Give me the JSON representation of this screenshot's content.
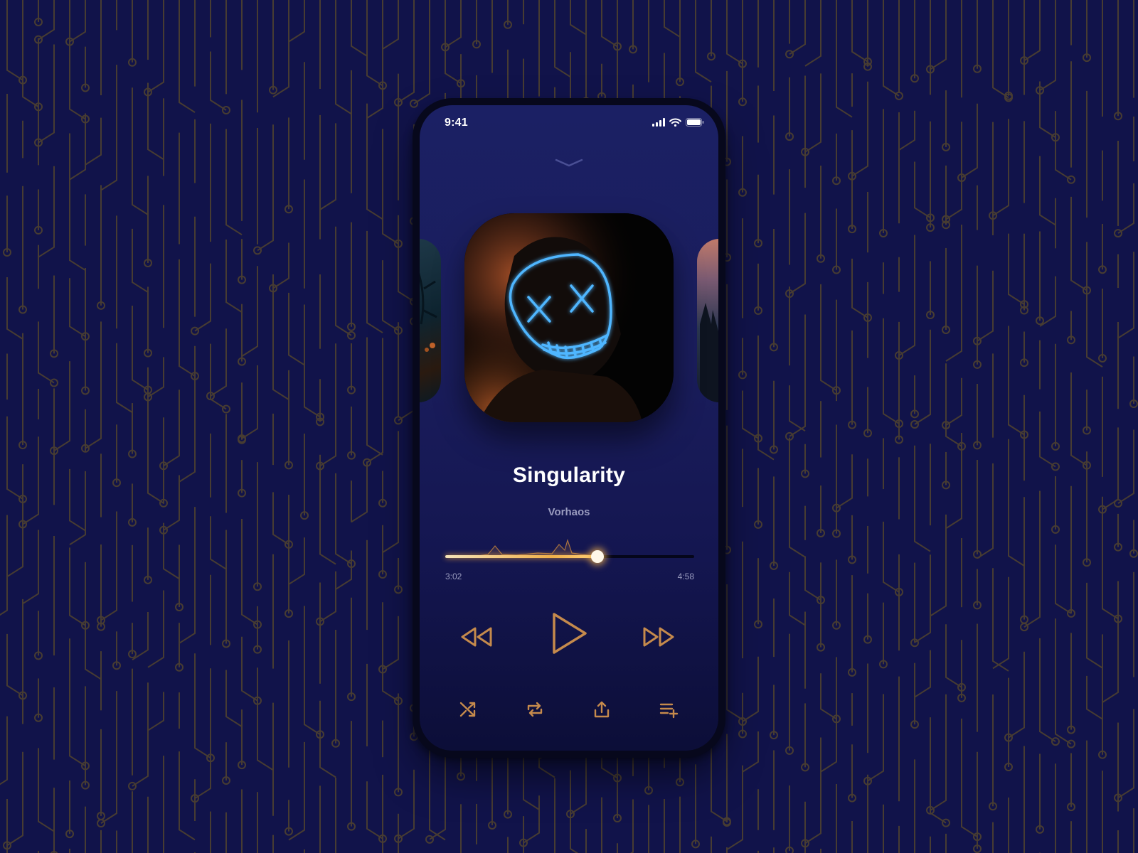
{
  "status_bar": {
    "time": "9:41"
  },
  "now_playing": {
    "title": "Singularity",
    "artist": "Vorhaos",
    "elapsed": "3:02",
    "duration": "4:58",
    "progress": 0.61
  },
  "controls": {
    "transport": [
      "rewind-icon",
      "play-icon",
      "fast-forward-icon"
    ],
    "tools": [
      "shuffle-icon",
      "repeat-icon",
      "share-icon",
      "add-to-queue-icon"
    ]
  },
  "colors": {
    "background": "#11134a",
    "circuit": "#5a4a2a",
    "accent": "#c58a4c",
    "text_secondary": "#9a9cbf",
    "progress_glow": "#f0b04a"
  }
}
